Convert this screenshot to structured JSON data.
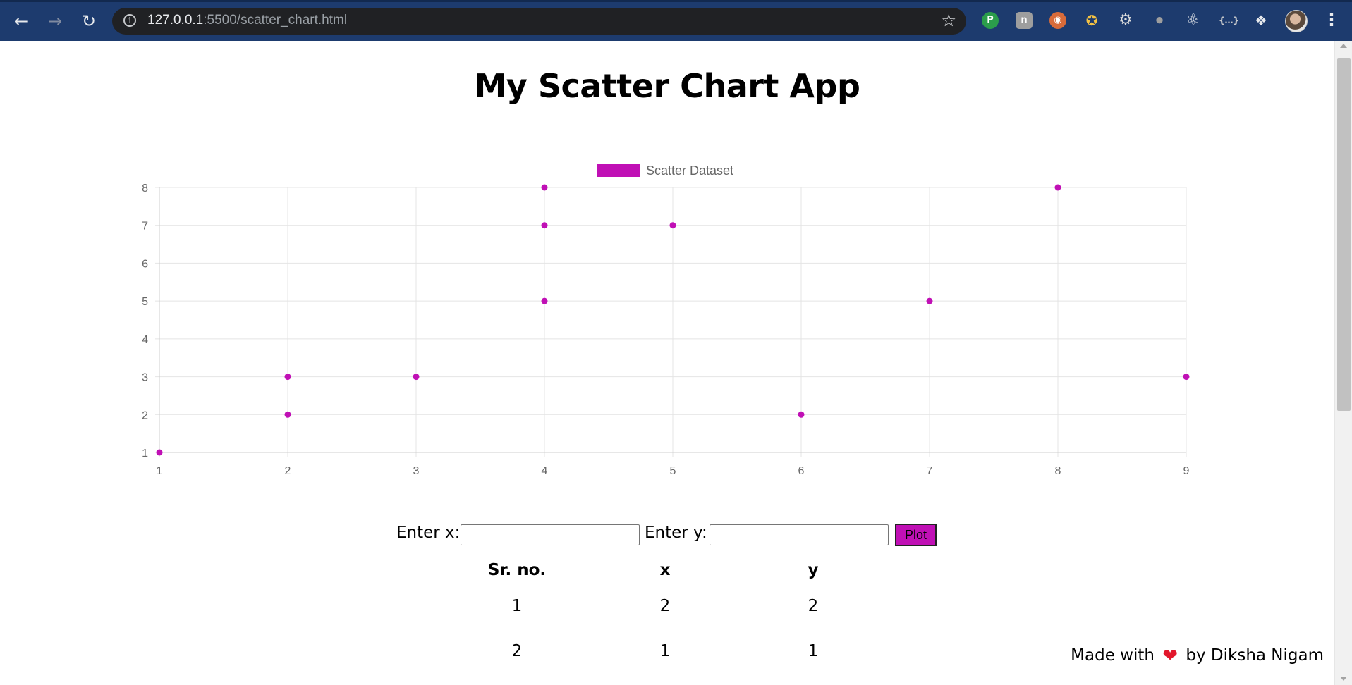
{
  "browser": {
    "url_host": "127.0.0.1",
    "url_rest": ":5500/scatter_chart.html",
    "extensions": [
      "pushbullet-icon",
      "notion-icon",
      "eyes-icon",
      "party-popper-icon",
      "gear-icon",
      "bottle-icon",
      "react-icon",
      "json-icon",
      "puzzle-icon"
    ]
  },
  "page": {
    "title": "My Scatter Chart App"
  },
  "chart_data": {
    "type": "scatter",
    "series": [
      {
        "name": "Scatter Dataset",
        "color": "#c010b5",
        "points": [
          [
            1,
            1
          ],
          [
            2,
            2
          ],
          [
            2,
            3
          ],
          [
            3,
            3
          ],
          [
            4,
            5
          ],
          [
            4,
            7
          ],
          [
            4,
            8
          ],
          [
            5,
            7
          ],
          [
            6,
            2
          ],
          [
            7,
            5
          ],
          [
            8,
            8
          ],
          [
            9,
            3
          ]
        ]
      }
    ],
    "xlim": [
      1,
      9
    ],
    "ylim": [
      1,
      8
    ],
    "xticks": [
      "1",
      "2",
      "3",
      "4",
      "5",
      "6",
      "7",
      "8",
      "9"
    ],
    "yticks": [
      "1",
      "2",
      "3",
      "4",
      "5",
      "6",
      "7",
      "8"
    ],
    "grid": true,
    "legend_position": "top-center"
  },
  "form": {
    "x_label": "Enter x:",
    "y_label": "Enter y:",
    "x_value": "",
    "y_value": "",
    "plot_label": "Plot"
  },
  "table": {
    "headers": [
      "Sr. no.",
      "x",
      "y"
    ],
    "rows": [
      [
        "1",
        "2",
        "2"
      ],
      [
        "2",
        "1",
        "1"
      ]
    ]
  },
  "footer": {
    "prefix": "Made with",
    "suffix": "by Diksha Nigam",
    "icon": "heart-icon"
  }
}
